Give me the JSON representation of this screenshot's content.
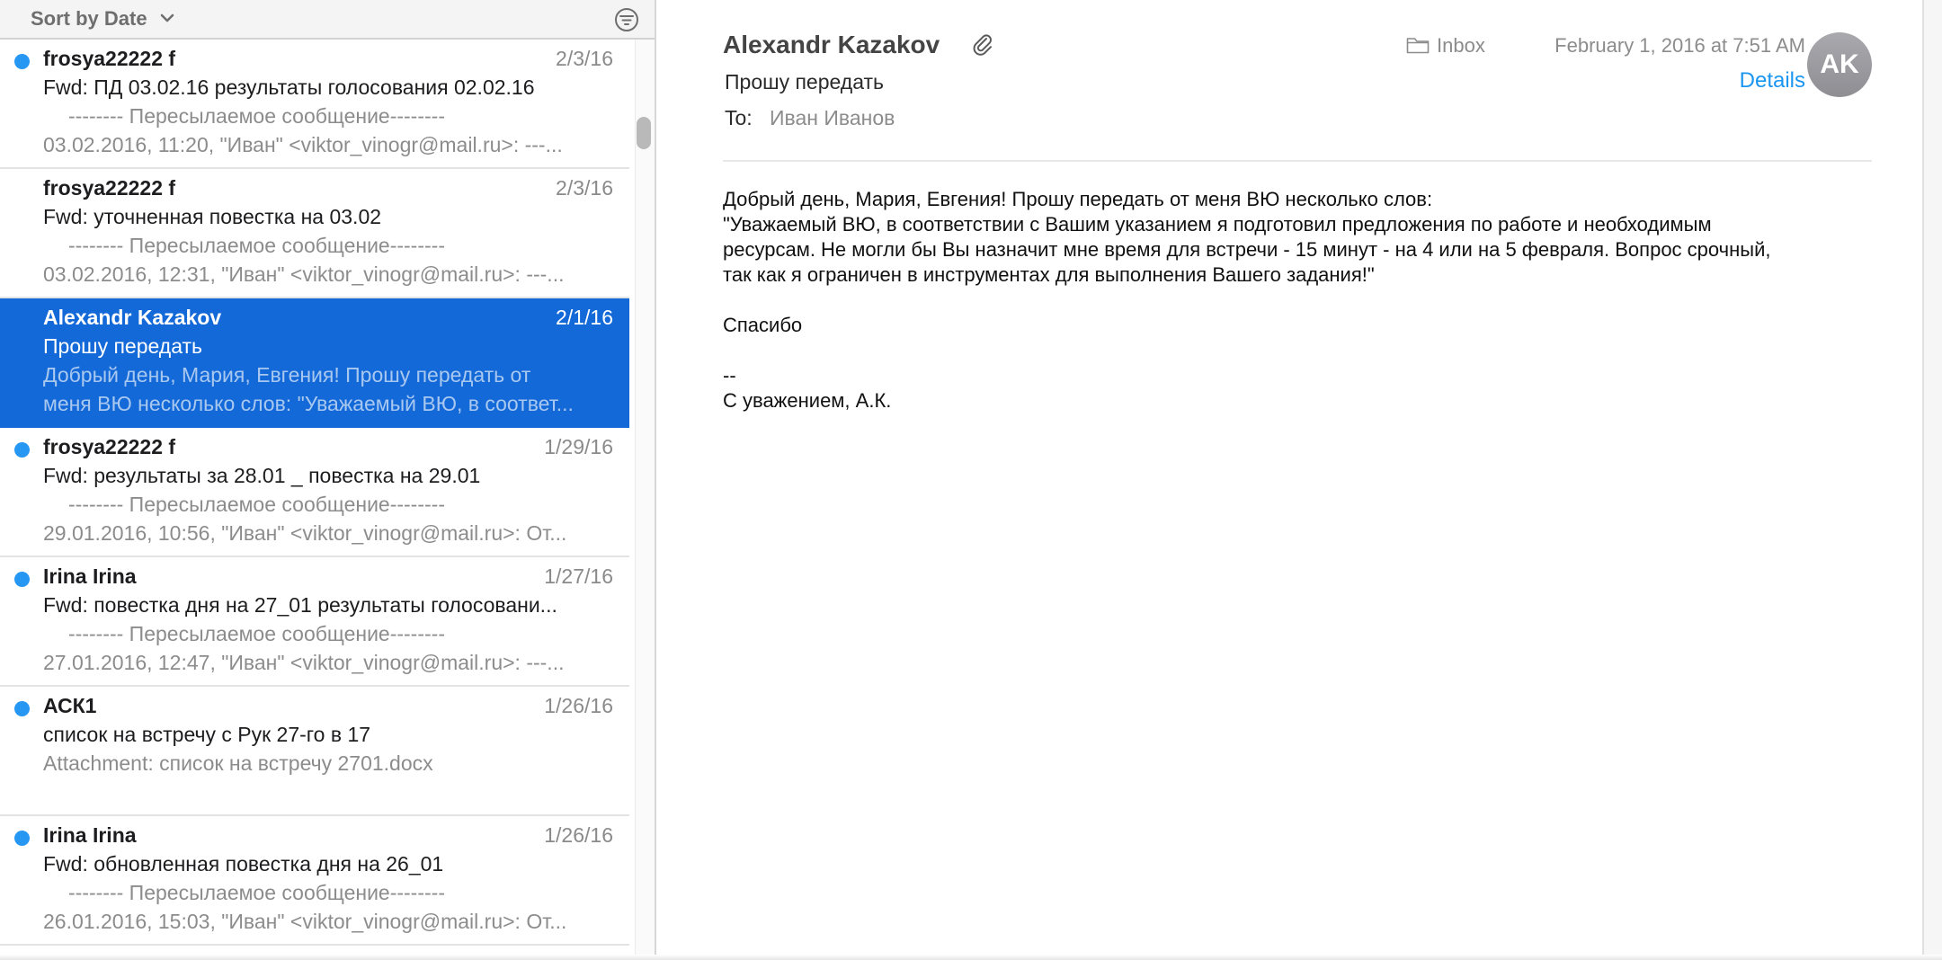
{
  "list": {
    "sort_label": "Sort by Date",
    "messages": [
      {
        "from": "frosya22222 f",
        "date": "2/3/16",
        "unread": true,
        "subject": "Fwd: ПД 03.02.16   результаты голосования 02.02.16",
        "preview_line1": "-------- Пересылаемое сообщение--------",
        "preview_line2": "03.02.2016, 11:20, \"Иван\" <viktor_vinogr@mail.ru>:   ---...",
        "selected": false
      },
      {
        "from": "frosya22222 f",
        "date": "2/3/16",
        "unread": false,
        "subject": "Fwd: уточненная повестка на 03.02",
        "preview_line1": "-------- Пересылаемое сообщение--------",
        "preview_line2": "03.02.2016, 12:31, \"Иван\" <viktor_vinogr@mail.ru>:   ---...",
        "selected": false
      },
      {
        "from": "Alexandr Kazakov",
        "date": "2/1/16",
        "unread": false,
        "subject": "Прошу передать",
        "preview_line1": "Добрый день, Мария, Евгения! Прошу передать от",
        "preview_line2": "меня ВЮ несколько слов: \"Уважаемый ВЮ, в соответ...",
        "selected": true
      },
      {
        "from": "frosya22222 f",
        "date": "1/29/16",
        "unread": true,
        "subject": "Fwd: результаты за 28.01 _ повестка на 29.01",
        "preview_line1": "-------- Пересылаемое сообщение--------",
        "preview_line2": "29.01.2016, 10:56, \"Иван\" <viktor_vinogr@mail.ru>:   От...",
        "selected": false
      },
      {
        "from": "Irina Irina",
        "date": "1/27/16",
        "unread": true,
        "subject": "Fwd: повестка дня на 27_01 результаты голосовани...",
        "preview_line1": "-------- Пересылаемое сообщение--------",
        "preview_line2": "27.01.2016, 12:47, \"Иван\" <viktor_vinogr@mail.ru>:   ---...",
        "selected": false
      },
      {
        "from": "АСК1",
        "date": "1/26/16",
        "unread": true,
        "subject": "список на встречу с Рук 27-го в 17",
        "preview_line1": "Attachment: список на встречу 2701.docx",
        "preview_line2": "",
        "selected": false
      },
      {
        "from": "Irina Irina",
        "date": "1/26/16",
        "unread": true,
        "subject": "Fwd: обновленная повестка дня на 26_01",
        "preview_line1": "-------- Пересылаемое сообщение--------",
        "preview_line2": "26.01.2016, 15:03, \"Иван\" <viktor_vinogr@mail.ru>:   От...",
        "selected": false
      }
    ]
  },
  "reader": {
    "sender": "Alexandr Kazakov",
    "subject": "Прошу передать",
    "to_label": "To:",
    "to_name": "Иван Иванов",
    "folder": "Inbox",
    "date": "February 1, 2016 at 7:51 AM",
    "details_label": "Details",
    "avatar_initials": "AK",
    "body": {
      "para1": "Добрый день, Мария, Евгения! Прошу передать от меня ВЮ несколько слов:\n\"Уважаемый ВЮ, в соответствии с Вашим указанием я подготовил предложения по работе и необходимым\nресурсам. Не могли бы Вы назначит мне время для встречи - 15 минут - на 4 или на 5 февраля. Вопрос срочный,\nтак как я ограничен в инструментах для выполнения Вашего задания!\"",
      "thanks": "Спасибо",
      "sig_dash": "--",
      "signature": "С уважением, А.К."
    }
  },
  "colors": {
    "selection": "#1469d8",
    "unread_dot": "#2797f4",
    "link": "#1b96f0"
  }
}
